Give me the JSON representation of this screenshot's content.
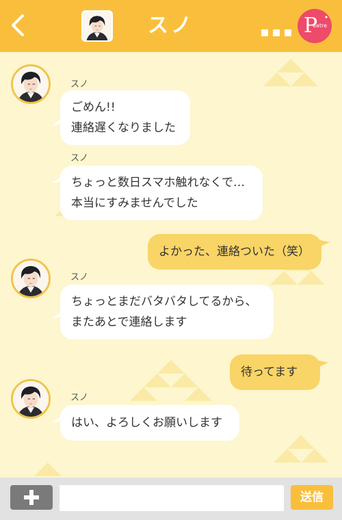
{
  "header": {
    "title": "スノ",
    "back_icon": "chevron-left-icon",
    "more_icon": "more-dots-icon",
    "logo_letter": "P",
    "logo_text": "eatre"
  },
  "colors": {
    "header": "#f9bf3c",
    "background": "#fdf6cf",
    "incoming_bubble": "#ffffff",
    "outgoing_bubble": "#f9d466",
    "logo": "#ee4a6a",
    "send_button": "#f9bf3c"
  },
  "messages": [
    {
      "sender": "スノ",
      "direction": "in",
      "lines": [
        "ごめん!!",
        "連絡遅くなりました"
      ]
    },
    {
      "sender": "スノ",
      "direction": "in",
      "lines": [
        "ちょっと数日スマホ触れなくで…",
        "本当にすみませんでした"
      ]
    },
    {
      "direction": "out",
      "lines": [
        "よかった、連絡ついた（笑）"
      ]
    },
    {
      "sender": "スノ",
      "direction": "in",
      "lines": [
        "ちょっとまだバタバタしてるから、",
        "またあとで連絡します"
      ]
    },
    {
      "direction": "out",
      "lines": [
        "待ってます"
      ]
    },
    {
      "sender": "スノ",
      "direction": "in",
      "lines": [
        "はい、よろしくお願いします"
      ]
    }
  ],
  "footer": {
    "plus_icon": "plus-icon",
    "input_value": "",
    "input_placeholder": "",
    "send_label": "送信"
  }
}
